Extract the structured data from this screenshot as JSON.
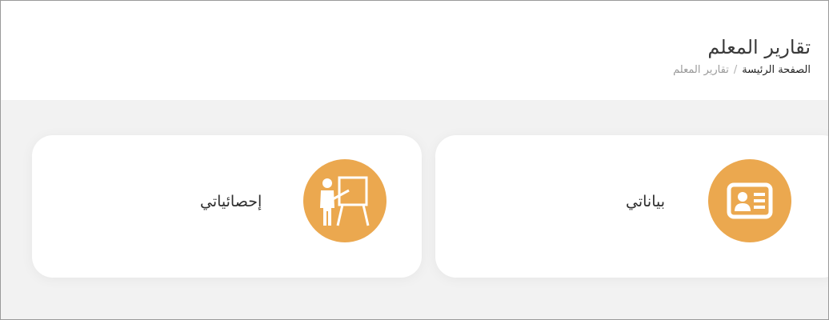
{
  "header": {
    "title": "تقارير المعلم",
    "breadcrumb": {
      "home": "الصفحة الرئيسة",
      "separator": "/",
      "current": "تقارير المعلم"
    }
  },
  "cards": [
    {
      "label": "بياناتي",
      "icon": "id-card-icon"
    },
    {
      "label": "إحصائياتي",
      "icon": "teacher-presentation-icon"
    }
  ],
  "colors": {
    "accent": "#eba84f",
    "background": "#f2f2f2",
    "card": "#ffffff"
  }
}
